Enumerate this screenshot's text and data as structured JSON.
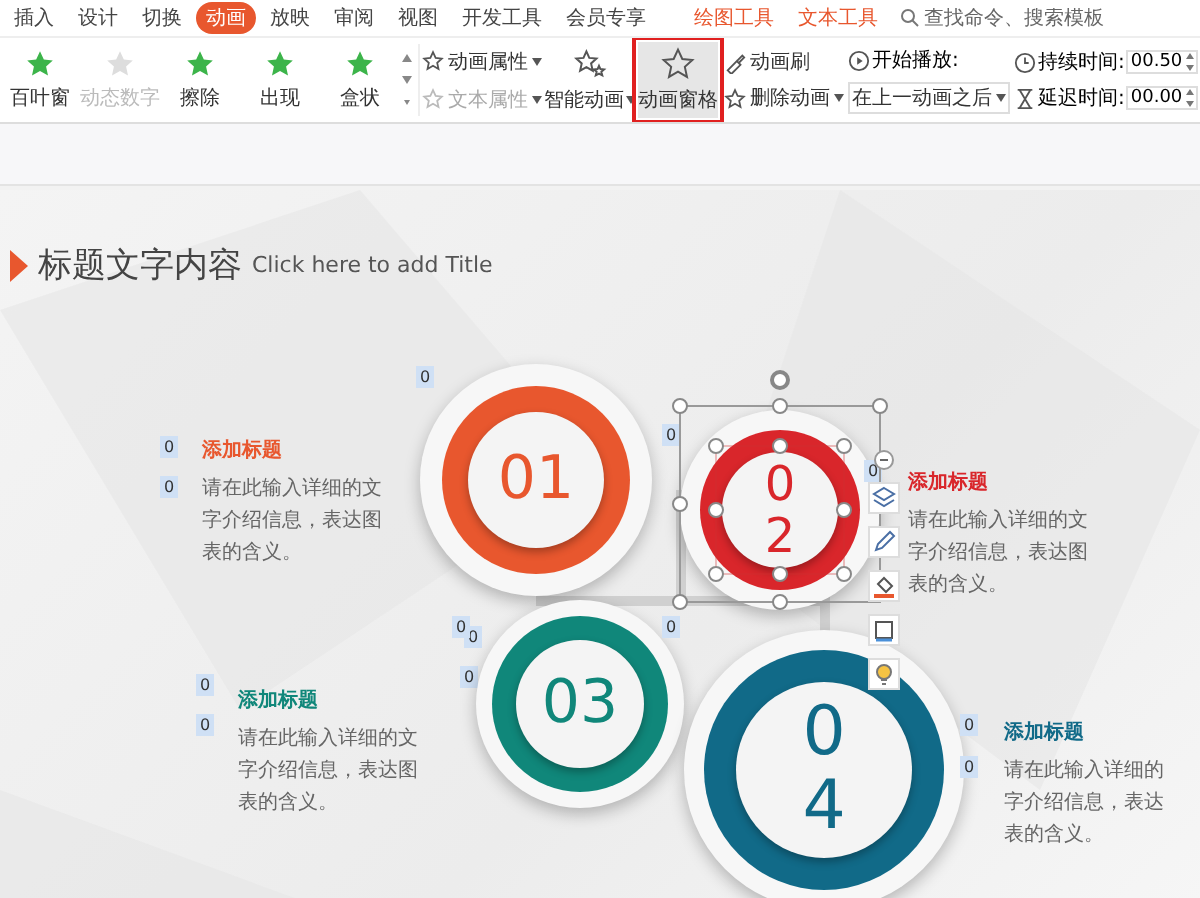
{
  "menu_tabs": [
    {
      "label": "插入",
      "selected": false
    },
    {
      "label": "设计",
      "selected": false
    },
    {
      "label": "切换",
      "selected": false
    },
    {
      "label": "动画",
      "selected": true
    },
    {
      "label": "放映",
      "selected": false
    },
    {
      "label": "审阅",
      "selected": false
    },
    {
      "label": "视图",
      "selected": false
    },
    {
      "label": "开发工具",
      "selected": false
    },
    {
      "label": "会员专享",
      "selected": false
    }
  ],
  "context_tabs": [
    "绘图工具",
    "文本工具"
  ],
  "search": {
    "placeholder": "查找命令、搜索模板"
  },
  "gallery": [
    {
      "label": "百叶窗",
      "disabled": false
    },
    {
      "label": "动态数字",
      "disabled": true
    },
    {
      "label": "擦除",
      "disabled": false
    },
    {
      "label": "出现",
      "disabled": false
    },
    {
      "label": "盒状",
      "disabled": false
    }
  ],
  "property_buttons": [
    {
      "label": "动画属性",
      "disabled": false
    },
    {
      "label": "文本属性",
      "disabled": true
    }
  ],
  "smart_animation": {
    "label": "智能动画"
  },
  "animation_pane": {
    "label": "动画窗格",
    "selected": true
  },
  "animation_brush": {
    "label": "动画刷"
  },
  "delete_animation": {
    "label": "删除动画"
  },
  "start": {
    "label": "开始播放:",
    "value": "在上一动画之后"
  },
  "duration": {
    "label": "持续时间:",
    "value": "00.50"
  },
  "delay": {
    "label": "延迟时间:",
    "value": "00.00"
  },
  "slide": {
    "title": "标题文字内容",
    "subtitle": "Click here to add Title",
    "items": [
      {
        "number": "01",
        "color": "#e8572e",
        "heading": "添加标题",
        "body": "请在此输入详细的文字介绍信息，表达图表的含义。",
        "tags": [
          "0",
          "0"
        ],
        "selected": false
      },
      {
        "number": "02",
        "color": "#d9262b",
        "heading": "添加标题",
        "body": "请在此输入详细的文字介绍信息，表达图表的含义。",
        "tags": [
          "0",
          "0"
        ],
        "selected": true
      },
      {
        "number": "03",
        "color": "#10877a",
        "heading": "添加标题",
        "body": "请在此输入详细的文字介绍信息，表达图表的含义。",
        "tags": [
          "0",
          "0"
        ],
        "selected": false
      },
      {
        "number": "04",
        "color": "#116a88",
        "heading": "添加标题",
        "body": "请在此输入详细的字介绍信息，表达表的含义。",
        "tags": [
          "0",
          "0"
        ],
        "selected": false
      }
    ],
    "circle_tags": [
      "0",
      "0",
      "0",
      "0",
      "0"
    ]
  }
}
